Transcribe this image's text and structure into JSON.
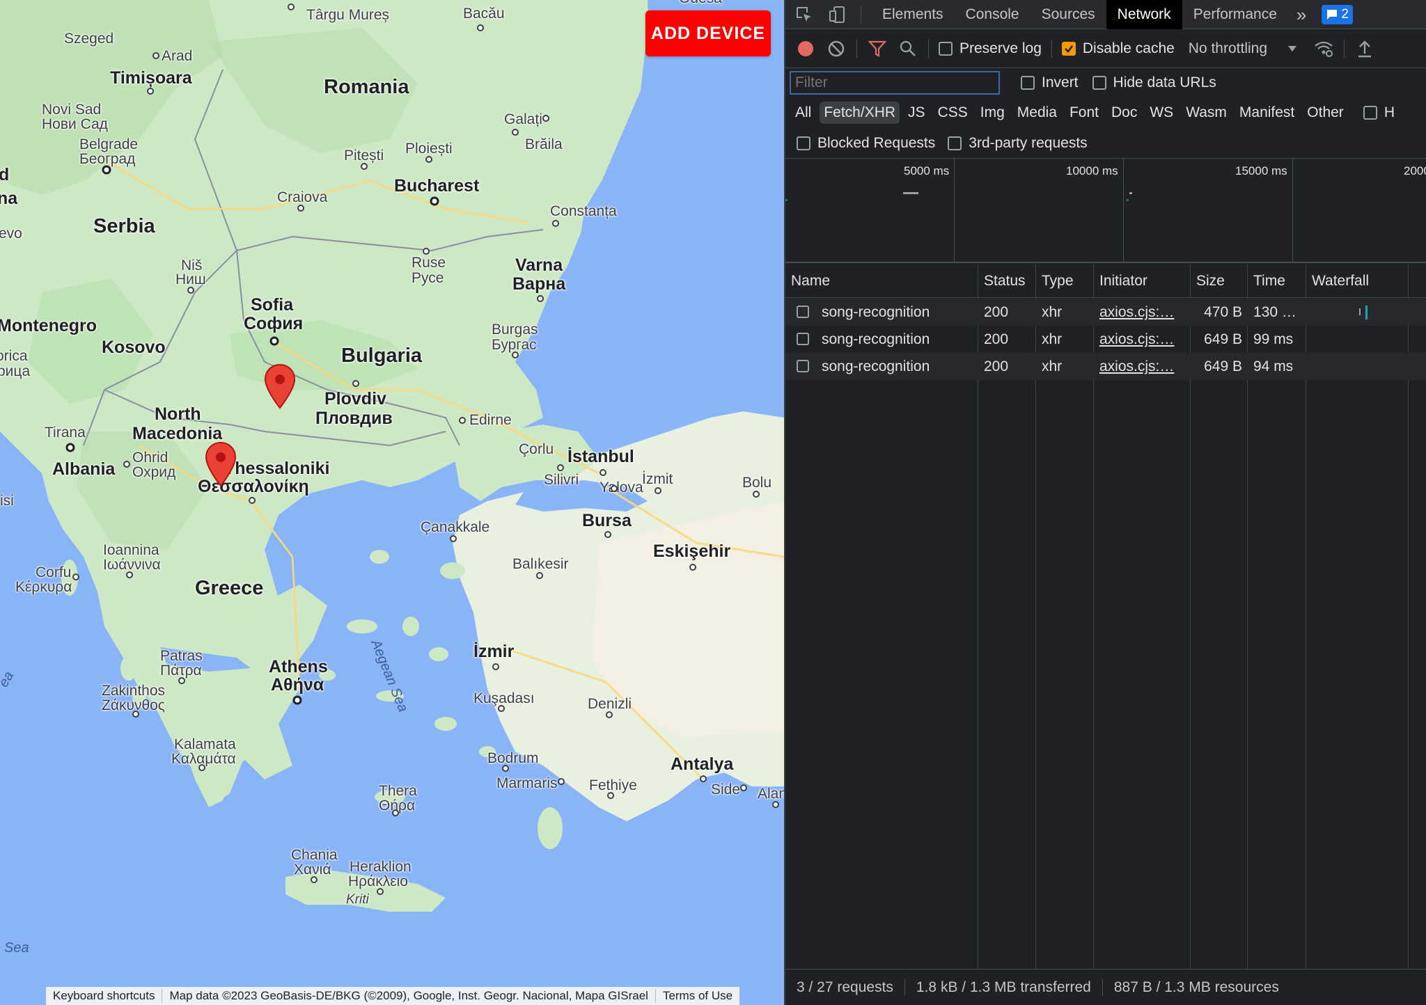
{
  "map": {
    "add_device_label": "ADD DEVICE",
    "attribution": {
      "shortcuts": "Keyboard shortcuts",
      "map_data": "Map data ©2023 GeoBasis-DE/BKG (©2009), Google, Inst. Geogr. Nacional, Mapa GISrael",
      "terms": "Terms of Use"
    },
    "labels": {
      "romania": "Romania",
      "serbia": "Serbia",
      "bulgaria": "Bulgaria",
      "kosovo": "Kosovo",
      "montenegro": "Montenegro",
      "north_macedonia_1": "North",
      "north_macedonia_2": "Macedonia",
      "albania": "Albania",
      "greece": "Greece",
      "bucharest": "Bucharest",
      "sofia": "Sofia",
      "sofia_cyr": "София",
      "plovdiv": "Plovdiv",
      "plovdiv_cyr": "Пловдив",
      "varna": "Varna",
      "varna_cyr": "Варна",
      "burgas": "Burgas",
      "burgas_cyr": "Бургас",
      "ruse": "Ruse",
      "ruse_cyr": "Русе",
      "istanbul": "İstanbul",
      "bursa": "Bursa",
      "eskisehir": "Eskişehir",
      "izmir": "İzmir",
      "antalya": "Antalya",
      "athens": "Athens",
      "athens_gr": "Αθήνα",
      "thessaloniki": "Thessaloniki",
      "thessaloniki_gr": "Θεσσαλονίκη",
      "timisoara": "Timișoara",
      "szeged": "Szeged",
      "arad": "Arad",
      "targu_mures": "Târgu Mureș",
      "bacau": "Bacău",
      "novi_sad": "Novi Sad",
      "novi_sad_cyr": "Нови Сад",
      "belgrade": "Belgrade",
      "belgrade_cyr": "Београд",
      "pitesti": "Pitești",
      "ploiesti": "Ploiești",
      "galati": "Galați",
      "braila": "Brăila",
      "craiova": "Craiova",
      "constanta": "Constanța",
      "nis": "Niš",
      "nis_cyr": "Ниш",
      "tirana": "Tirana",
      "ohrid": "Ohrid",
      "ohrid_cyr": "Охрид",
      "edirne": "Edirne",
      "corlu": "Çorlu",
      "silivri": "Silivri",
      "izmit": "İzmit",
      "yalova": "Yalova",
      "bolu": "Bolu",
      "canakkale": "Çanakkale",
      "balikesir": "Balıkesir",
      "ioannina": "Ioannina",
      "ioannina_gr": "Ιωάννινα",
      "corfu": "Corfu",
      "corfu_gr": "Κέρκυρα",
      "patras": "Patras",
      "patras_gr": "Πάτρα",
      "zakinthos": "Zakinthos",
      "zakinthos_gr": "Ζάκυνθος",
      "kalamata": "Kalamata",
      "kalamata_gr": "Καλαμάτα",
      "kusadasi": "Kuşadası",
      "denizli": "Denizli",
      "bodrum": "Bodrum",
      "marmaris": "Marmaris",
      "fethiye": "Fethiye",
      "side": "Side",
      "alanya": "Alan",
      "thera": "Thera",
      "thera_gr": "Θήρα",
      "chania": "Chania",
      "chania_gr": "Χανιά",
      "heraklion": "Heraklion",
      "heraklion_gr": "Ηράκλειο",
      "kriti": "Kriti",
      "aegean_sea": "Aegean Sea",
      "sea": "Sea",
      "odesa": "Odesa",
      "ea": "ea",
      "isi": "isi",
      "d": "d",
      "na": "na",
      "evo": "evo",
      "orica": "orica",
      "rica_cyr": "рица"
    }
  },
  "devtools": {
    "tabs": [
      "Elements",
      "Console",
      "Sources",
      "Network",
      "Performance"
    ],
    "active_tab": "Network",
    "more_tabs": "»",
    "issues_badge": "2",
    "toolbar": {
      "preserve_log": "Preserve log",
      "disable_cache": "Disable cache",
      "throttling": "No throttling"
    },
    "filter": {
      "placeholder": "Filter",
      "invert": "Invert",
      "hide_data_urls": "Hide data URLs",
      "h_cut": "H"
    },
    "types": [
      "All",
      "Fetch/XHR",
      "JS",
      "CSS",
      "Img",
      "Media",
      "Font",
      "Doc",
      "WS",
      "Wasm",
      "Manifest",
      "Other"
    ],
    "active_type": "Fetch/XHR",
    "blocked_requests": "Blocked Requests",
    "third_party": "3rd-party requests",
    "overview_ticks": [
      "5000 ms",
      "10000 ms",
      "15000 ms",
      "2000"
    ],
    "columns": [
      "Name",
      "Status",
      "Type",
      "Initiator",
      "Size",
      "Time",
      "Waterfall"
    ],
    "rows": [
      {
        "name": "song-recognition",
        "status": "200",
        "type": "xhr",
        "initiator": "axios.cjs:…",
        "size": "470 B",
        "time": "130 …"
      },
      {
        "name": "song-recognition",
        "status": "200",
        "type": "xhr",
        "initiator": "axios.cjs:…",
        "size": "649 B",
        "time": "99 ms"
      },
      {
        "name": "song-recognition",
        "status": "200",
        "type": "xhr",
        "initiator": "axios.cjs:…",
        "size": "649 B",
        "time": "94 ms"
      }
    ],
    "status_bar": {
      "requests": "3 / 27 requests",
      "transferred": "1.8 kB / 1.3 MB transferred",
      "resources": "887 B / 1.3 MB resources"
    },
    "colors": {
      "record": "#e46962",
      "filter_icon": "#e46962",
      "checkbox_checked": "#f29900",
      "waterfall_bar": "#1ba1b5"
    }
  }
}
